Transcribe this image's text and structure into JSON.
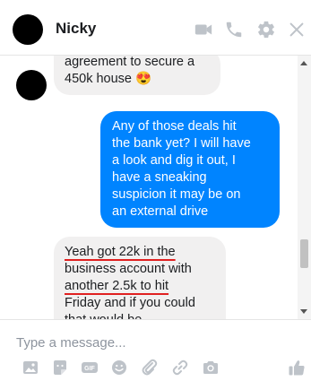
{
  "header": {
    "contact_name": "Nicky",
    "icons": [
      "video-camera-icon",
      "phone-icon",
      "gear-icon",
      "close-icon"
    ]
  },
  "messages": [
    {
      "direction": "incoming",
      "lines": [
        "agreement to secure a",
        "450k house 😍"
      ]
    },
    {
      "direction": "outgoing",
      "lines": [
        "Any of those deals hit",
        "the bank yet? I will have",
        "a look and dig it out, I",
        "have a sneaking",
        "suspicion it may be on",
        "an external drive"
      ]
    },
    {
      "direction": "incoming",
      "lines": [
        "Yeah got 22k in the",
        "business account with",
        "another 2.5k to hit",
        "Friday and if you could",
        "that would be"
      ],
      "underlined_lines": [
        0,
        2
      ]
    }
  ],
  "composer": {
    "placeholder": "Type a message...",
    "value": "",
    "tools": [
      "image-icon",
      "sticker-icon",
      "gif-icon",
      "emoji-icon",
      "attach-icon",
      "link-icon",
      "camera-icon",
      "thumbs-up-icon"
    ]
  },
  "colors": {
    "outgoing_bubble": "#0084ff",
    "incoming_bubble": "#f1f0f0",
    "icon_gray": "#bec3c9",
    "underline_red": "#e02020"
  }
}
